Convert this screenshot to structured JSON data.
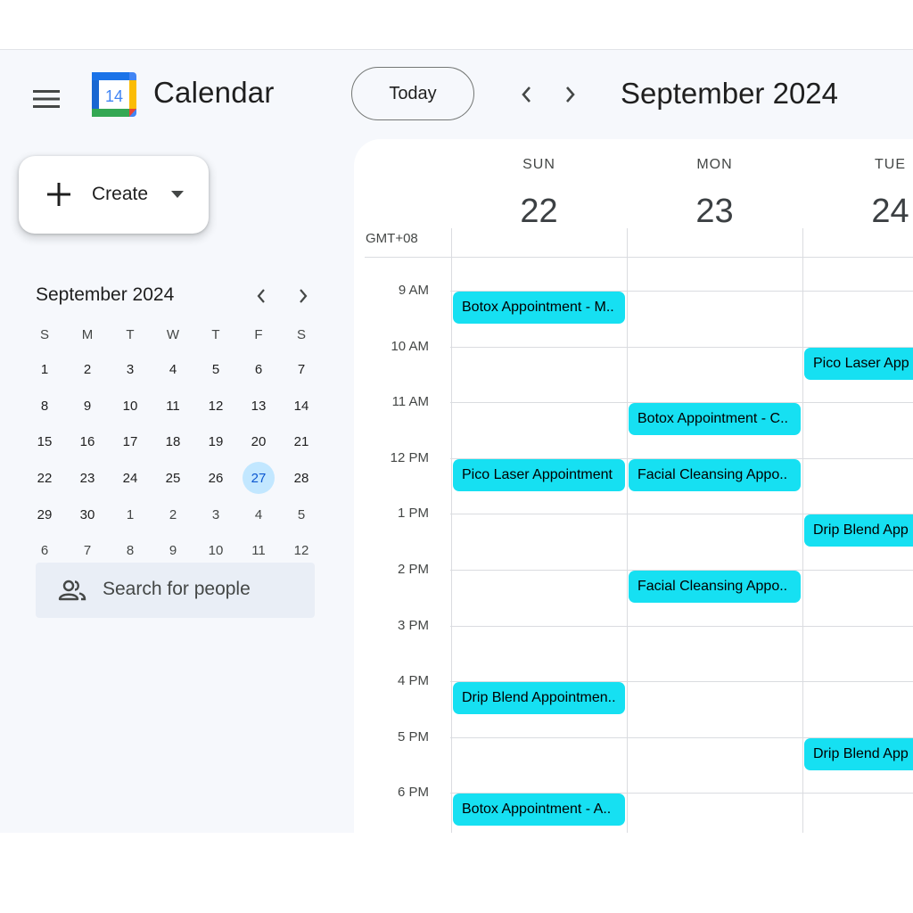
{
  "header": {
    "app_title": "Calendar",
    "logo_number": "14",
    "today_label": "Today",
    "month_title": "September 2024"
  },
  "create": {
    "label": "Create"
  },
  "mini_calendar": {
    "title": "September 2024",
    "dow": [
      "S",
      "M",
      "T",
      "W",
      "T",
      "F",
      "S"
    ],
    "weeks": [
      [
        "1",
        "2",
        "3",
        "4",
        "5",
        "6",
        "7"
      ],
      [
        "8",
        "9",
        "10",
        "11",
        "12",
        "13",
        "14"
      ],
      [
        "15",
        "16",
        "17",
        "18",
        "19",
        "20",
        "21"
      ],
      [
        "22",
        "23",
        "24",
        "25",
        "26",
        "27",
        "28"
      ],
      [
        "29",
        "30",
        "1",
        "2",
        "3",
        "4",
        "5"
      ],
      [
        "6",
        "7",
        "8",
        "9",
        "10",
        "11",
        "12"
      ]
    ],
    "selected_day": "27"
  },
  "search_people": {
    "placeholder": "Search for people"
  },
  "calendar": {
    "timezone": "GMT+08",
    "days": [
      {
        "dow": "SUN",
        "num": "22"
      },
      {
        "dow": "MON",
        "num": "23"
      },
      {
        "dow": "TUE",
        "num": "24"
      }
    ],
    "hours": [
      "9 AM",
      "10 AM",
      "11 AM",
      "12 PM",
      "1 PM",
      "2 PM",
      "3 PM",
      "4 PM",
      "5 PM",
      "6 PM"
    ],
    "events": [
      {
        "day": 0,
        "hour": 0,
        "title": "Botox Appointment - M.."
      },
      {
        "day": 2,
        "hour": 1,
        "title": "Pico Laser App"
      },
      {
        "day": 1,
        "hour": 2,
        "title": "Botox Appointment - C.."
      },
      {
        "day": 0,
        "hour": 3,
        "title": "Pico Laser Appointment"
      },
      {
        "day": 1,
        "hour": 3,
        "title": "Facial Cleansing Appo.."
      },
      {
        "day": 2,
        "hour": 4,
        "title": "Drip Blend App"
      },
      {
        "day": 1,
        "hour": 5,
        "title": "Facial Cleansing Appo.."
      },
      {
        "day": 0,
        "hour": 7,
        "title": "Drip Blend Appointmen.."
      },
      {
        "day": 2,
        "hour": 8,
        "title": "Drip Blend App"
      },
      {
        "day": 0,
        "hour": 9,
        "title": "Botox Appointment - A.."
      }
    ],
    "event_color": "#16e0f2"
  }
}
